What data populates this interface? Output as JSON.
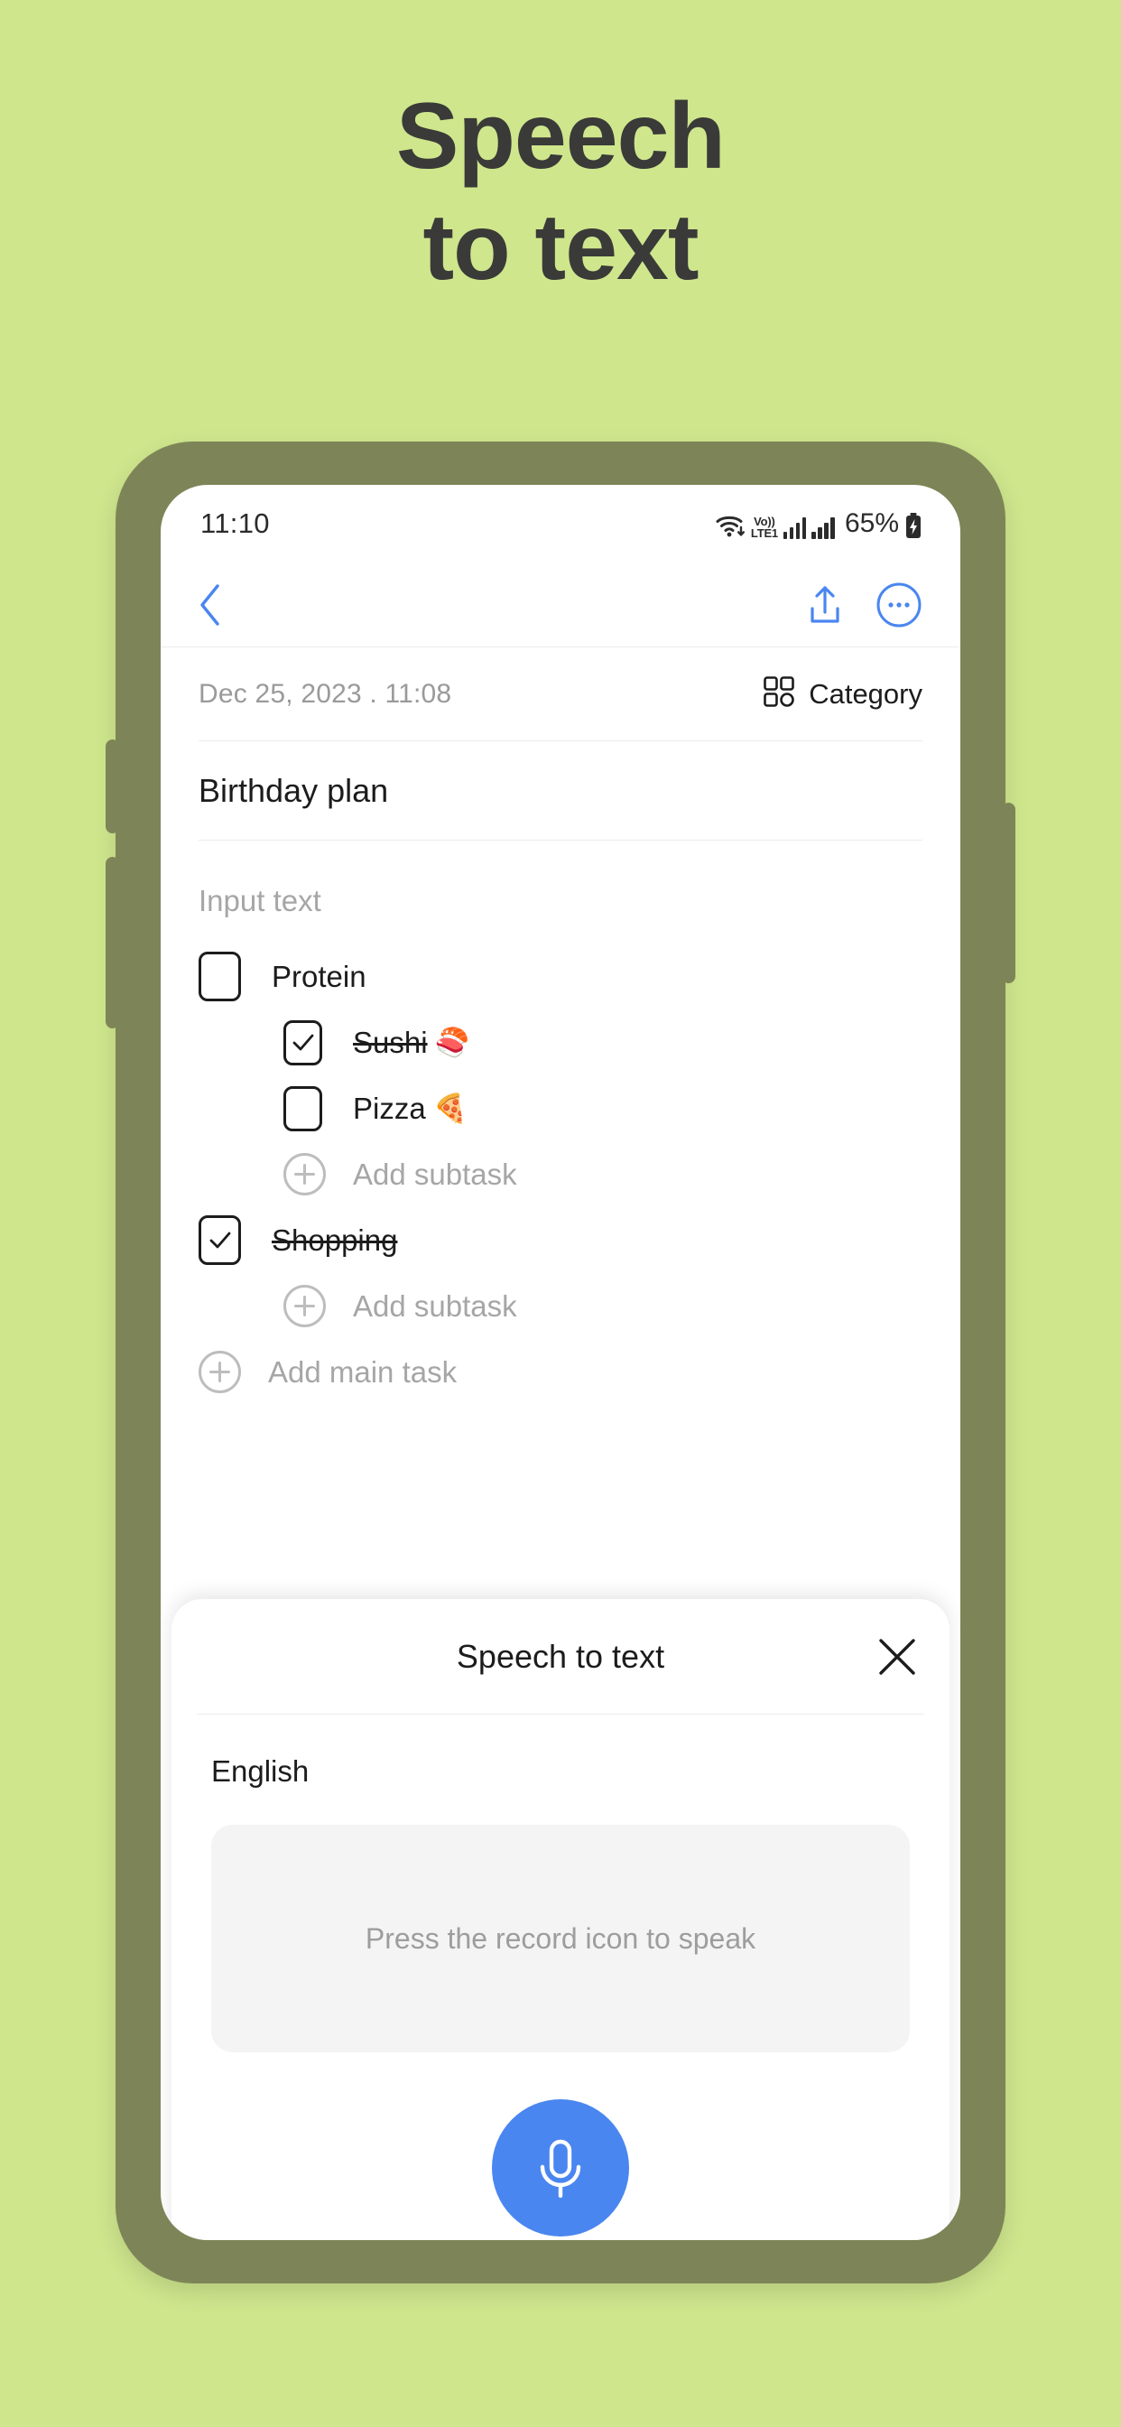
{
  "hero": {
    "line1": "Speech",
    "line2": "to text"
  },
  "colors": {
    "background": "#cfe68d",
    "phone_frame": "#7d8558",
    "accent_blue": "#4a86f0",
    "heading": "#3a3a38",
    "muted_text": "#a6a6a6"
  },
  "statusbar": {
    "time": "11:10",
    "wifi_icon": "wifi-icon",
    "volte_top": "Vo))",
    "volte_bottom": "LTE1",
    "signal_icon_1": "signal-bars-icon",
    "signal_icon_2": "signal-bars-icon",
    "battery_percent": "65%",
    "battery_icon": "battery-charging-icon"
  },
  "appbar": {
    "back_icon": "chevron-left-icon",
    "share_icon": "share-upload-icon",
    "more_icon": "more-options-icon"
  },
  "note": {
    "date": "Dec 25, 2023 . 11:08",
    "category_icon": "category-grid-icon",
    "category_label": "Category",
    "title": "Birthday plan",
    "body_placeholder": "Input text"
  },
  "tasks": [
    {
      "label": "Protein",
      "checked": false,
      "emoji": "",
      "add_subtask_label": "Add subtask",
      "subtasks": [
        {
          "label": "Sushi",
          "emoji": "🍣",
          "checked": true
        },
        {
          "label": "Pizza",
          "emoji": "🍕",
          "checked": false
        }
      ]
    },
    {
      "label": "Shopping",
      "checked": true,
      "emoji": "",
      "add_subtask_label": "Add subtask",
      "subtasks": []
    }
  ],
  "add_main_task_label": "Add main task",
  "speech_sheet": {
    "title": "Speech to text",
    "close_icon": "close-icon",
    "language": "English",
    "record_hint": "Press the record icon to speak",
    "mic_icon": "microphone-icon"
  }
}
